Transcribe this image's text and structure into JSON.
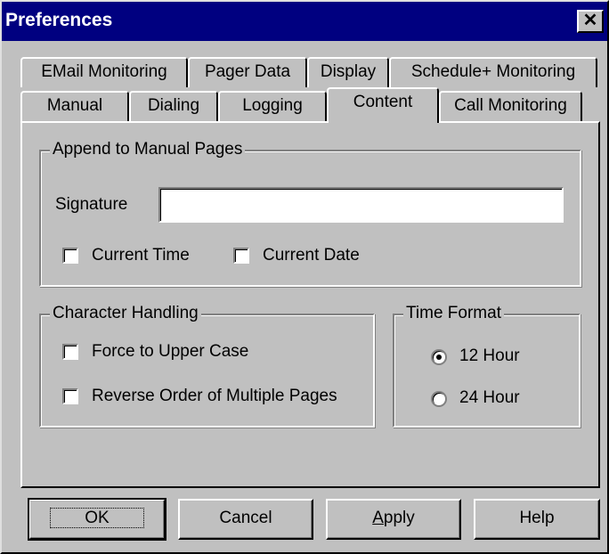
{
  "window": {
    "title": "Preferences",
    "close_glyph": "✕"
  },
  "tabs": {
    "row1": [
      {
        "label": "EMail Monitoring"
      },
      {
        "label": "Pager Data"
      },
      {
        "label": "Display"
      },
      {
        "label": "Schedule+ Monitoring"
      }
    ],
    "row2": [
      {
        "label": "Manual"
      },
      {
        "label": "Dialing"
      },
      {
        "label": "Logging"
      },
      {
        "label": "Content",
        "selected": true
      },
      {
        "label": "Call Monitoring"
      }
    ]
  },
  "append_group": {
    "legend": "Append to Manual Pages",
    "signature_label": "Signature",
    "signature_value": "",
    "current_time": {
      "label": "Current Time",
      "checked": false
    },
    "current_date": {
      "label": "Current Date",
      "checked": false
    }
  },
  "char_group": {
    "legend": "Character Handling",
    "upper_case": {
      "label": "Force to Upper Case",
      "checked": false
    },
    "reverse_order": {
      "label": "Reverse Order of Multiple Pages",
      "checked": false
    }
  },
  "time_group": {
    "legend": "Time Format",
    "hour12": {
      "label": "12 Hour",
      "selected": true
    },
    "hour24": {
      "label": "24 Hour",
      "selected": false
    }
  },
  "buttons": {
    "ok": "OK",
    "cancel": "Cancel",
    "apply_mnemonic": "A",
    "apply_rest": "pply",
    "help": "Help"
  }
}
